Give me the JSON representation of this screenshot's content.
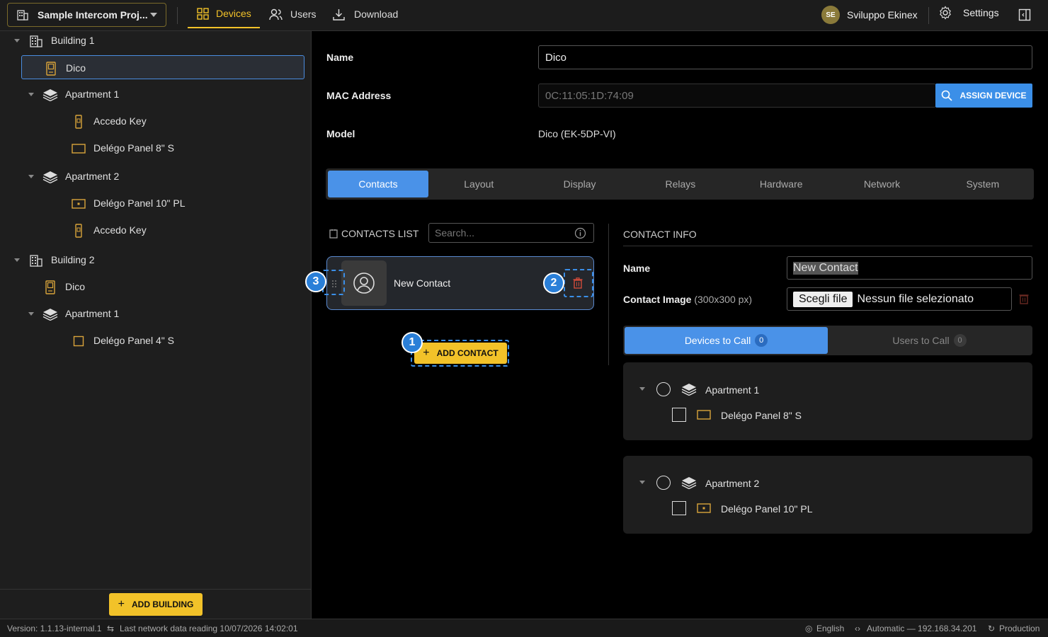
{
  "topbar": {
    "project_name": "Sample Intercom Proj...",
    "nav_devices": "Devices",
    "nav_users": "Users",
    "nav_download": "Download",
    "user_initials": "SE",
    "user_name": "Sviluppo Ekinex",
    "settings": "Settings"
  },
  "tree": [
    {
      "label": "Building 1",
      "icon": "building-icon"
    },
    {
      "label": "Dico",
      "icon": "intercom-device-icon",
      "selected": true
    },
    {
      "label": "Apartment 1",
      "icon": "layers-icon"
    },
    {
      "label": "Accedo Key",
      "icon": "keypad-icon"
    },
    {
      "label": "Delégo Panel 8\" S",
      "icon": "panel-icon"
    },
    {
      "label": "Apartment 2",
      "icon": "layers-icon"
    },
    {
      "label": "Delégo Panel 10\" PL",
      "icon": "panel-icon"
    },
    {
      "label": "Accedo Key",
      "icon": "keypad-icon"
    },
    {
      "label": "Building 2",
      "icon": "building-icon"
    },
    {
      "label": "Dico",
      "icon": "intercom-device-icon"
    },
    {
      "label": "Apartment 1",
      "icon": "layers-icon"
    },
    {
      "label": "Delégo Panel 4\" S",
      "icon": "panel-icon"
    }
  ],
  "sidebar": {
    "add_building": "ADD BUILDING"
  },
  "device": {
    "name_label": "Name",
    "name_value": "Dico",
    "mac_label": "MAC Address",
    "mac_value": "0C:11:05:1D:74:09",
    "assign_button": "ASSIGN DEVICE",
    "model_label": "Model",
    "model_value": "Dico (EK-5DP-VI)"
  },
  "tabs": [
    "Contacts",
    "Layout",
    "Display",
    "Relays",
    "Hardware",
    "Network",
    "System"
  ],
  "contacts": {
    "list_title": "CONTACTS LIST",
    "search_placeholder": "Search...",
    "contact_name": "New Contact",
    "add_button": "ADD CONTACT",
    "badges": [
      "1",
      "2",
      "3"
    ]
  },
  "contact_info": {
    "title": "CONTACT INFO",
    "name_label": "Name",
    "name_value": "New Contact",
    "image_label": "Contact Image",
    "image_hint": "(300x300 px)",
    "file_button": "Scegli file",
    "file_status": "Nessun file selezionato",
    "tab_devices": "Devices to Call",
    "tab_devices_count": "0",
    "tab_users": "Users to Call",
    "tab_users_count": "0",
    "groups": [
      {
        "apartment": "Apartment 1",
        "device": "Delégo Panel 8\" S"
      },
      {
        "apartment": "Apartment 2",
        "device": "Delégo Panel 10\" PL"
      }
    ]
  },
  "status": {
    "version": "Version: 1.1.13-internal.1",
    "last_reading": "Last network data reading 10/07/2026 14:02:01",
    "language": "English",
    "network": "Automatic — 192.168.34.201",
    "env": "Production"
  },
  "colors": {
    "accent": "#f2c229",
    "primary": "#4a92e8"
  }
}
